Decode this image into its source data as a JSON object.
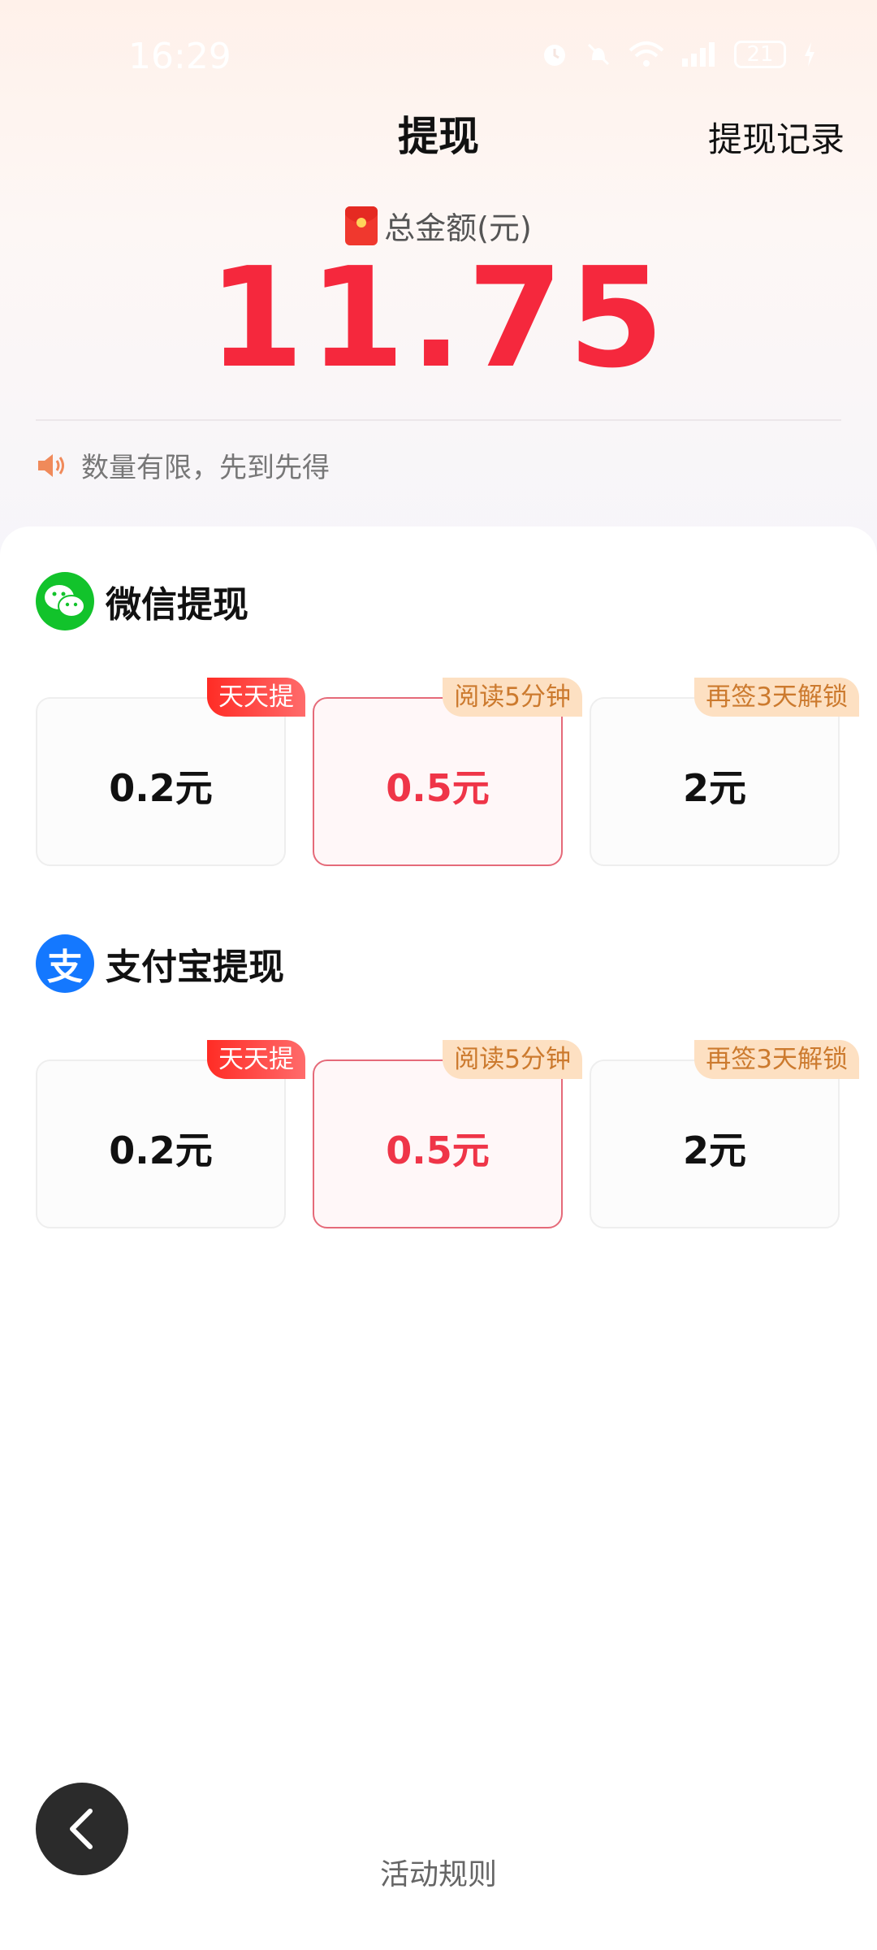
{
  "status_bar": {
    "time": "16:29",
    "battery": "21"
  },
  "header": {
    "title": "提现",
    "record_link": "提现记录"
  },
  "balance": {
    "label": "总金额(元)",
    "amount": "11.75"
  },
  "notice": {
    "text": "数量有限，先到先得"
  },
  "wechat": {
    "title": "微信提现",
    "options": [
      {
        "value": "0.2元",
        "tag": "天天提",
        "selected": false
      },
      {
        "value": "0.5元",
        "tag": "阅读5分钟",
        "selected": true
      },
      {
        "value": "2元",
        "tag": "再签3天解锁",
        "selected": false
      }
    ]
  },
  "alipay": {
    "title": "支付宝提现",
    "icon_glyph": "支",
    "options": [
      {
        "value": "0.2元",
        "tag": "天天提",
        "selected": false
      },
      {
        "value": "0.5元",
        "tag": "阅读5分钟",
        "selected": true
      },
      {
        "value": "2元",
        "tag": "再签3天解锁",
        "selected": false
      }
    ]
  },
  "footer": {
    "rules_link": "活动规则"
  },
  "colors": {
    "accent_red": "#f5283d",
    "wechat_green": "#12c32b",
    "alipay_blue": "#1478ff",
    "tag_peach": "#fde0c2"
  }
}
